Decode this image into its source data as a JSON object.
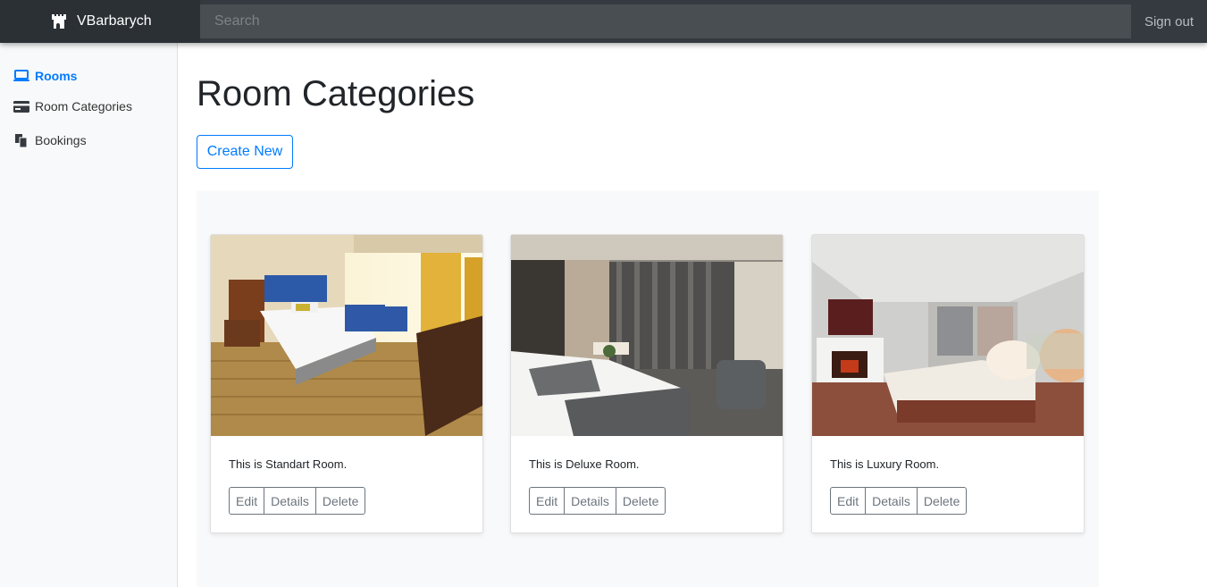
{
  "navbar": {
    "brand": "VBarbarych",
    "brand_icon": "castle-icon",
    "search_placeholder": "Search",
    "signout": "Sign out"
  },
  "sidebar": {
    "items": [
      {
        "label": "Rooms",
        "icon": "laptop-icon",
        "active": true
      },
      {
        "label": "Room Categories",
        "icon": "credit-card-icon",
        "active": false
      },
      {
        "label": "Bookings",
        "icon": "copy-icon",
        "active": false
      }
    ]
  },
  "main": {
    "title": "Room Categories",
    "create_label": "Create New",
    "cards": [
      {
        "text": "This is Standart Room.",
        "edit": "Edit",
        "details": "Details",
        "delete": "Delete"
      },
      {
        "text": "This is Deluxe Room.",
        "edit": "Edit",
        "details": "Details",
        "delete": "Delete"
      },
      {
        "text": "This is Luxury Room.",
        "edit": "Edit",
        "details": "Details",
        "delete": "Delete"
      }
    ]
  },
  "colors": {
    "navbar": "#343a40",
    "accent": "#007bff",
    "secondary": "#6c757d",
    "sidebar": "#f8f9fa"
  }
}
